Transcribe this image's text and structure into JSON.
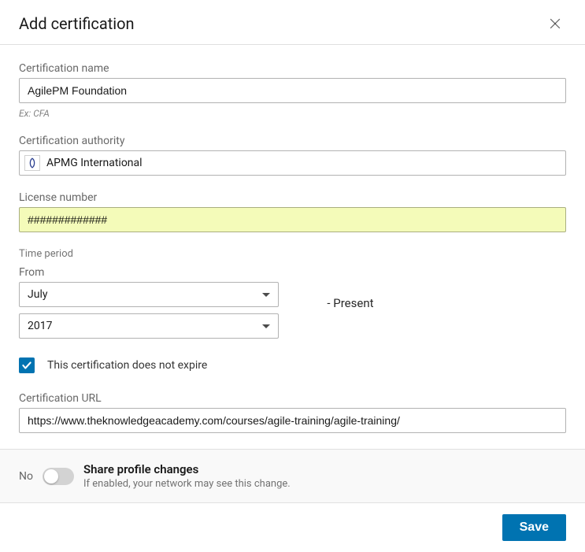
{
  "header": {
    "title": "Add certification"
  },
  "cert_name": {
    "label": "Certification name",
    "value": "AgilePM Foundation",
    "hint": "Ex: CFA"
  },
  "authority": {
    "label": "Certification authority",
    "value": "APMG International"
  },
  "license": {
    "label": "License number",
    "value": "#############"
  },
  "time_period": {
    "heading": "Time period",
    "from_label": "From",
    "month": "July",
    "year": "2017",
    "present": "- Present"
  },
  "no_expire": {
    "label": "This certification does not expire"
  },
  "url": {
    "label": "Certification URL",
    "value": "https://www.theknowledgeacademy.com/courses/agile-training/agile-training/"
  },
  "share": {
    "no": "No",
    "title": "Share profile changes",
    "sub": "If enabled, your network may see this change."
  },
  "footer": {
    "save": "Save"
  }
}
